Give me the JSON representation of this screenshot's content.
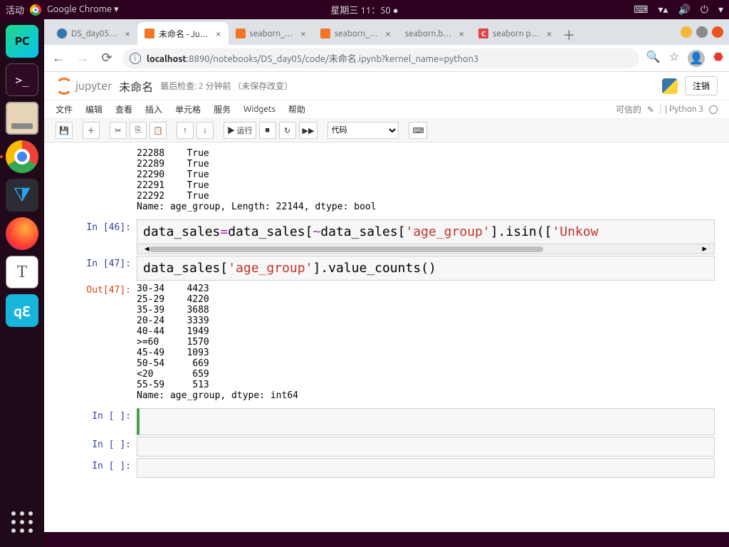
{
  "panel": {
    "activities": "活动",
    "app_title": "Google Chrome ▾",
    "clock": "星期三 11：50 ●"
  },
  "tabs": {
    "t1": "DS_day05…",
    "t2": "未命名 - Ju…",
    "t3": "seaborn_…",
    "t4": "seaborn_…",
    "t5": "seaborn.b…",
    "t6": "seaborn p…"
  },
  "addr": {
    "host": "localhost",
    "path": ":8890/notebooks/DS_day05/code/未命名.ipynb?kernel_name=python3"
  },
  "jy": {
    "brand": "jupyter",
    "title": "未命名",
    "checkpoint": "最后检查: 2 分钟前 （未保存改变）",
    "logout": "注销",
    "menu": {
      "file": "文件",
      "edit": "编辑",
      "view": "查看",
      "insert": "插入",
      "cell": "单元格",
      "kernel": "服务",
      "widgets": "Widgets",
      "help": "帮助"
    },
    "trusted": "可信的",
    "kernel": "Python 3",
    "run": "▶ 运行",
    "celltype": "代码"
  },
  "cells": {
    "out_top": "22288    True\n22289    True\n22290    True\n22291    True\n22292    True\nName: age_group, Length: 22144, dtype: bool",
    "in46_prompt": "In [46]:",
    "in47_prompt": "In [47]:",
    "out47_prompt": "Out[47]:",
    "empty_prompt": "In [ ]:",
    "out47": "30-34    4423\n25-29    4220\n35-39    3688\n20-24    3339\n40-44    1949\n>=60     1570\n45-49    1093\n50-54     669\n<20       659\n55-59     513\nName: age_group, dtype: int64",
    "code46_parts": {
      "a": "data_sales",
      "b": "=",
      "c": "data_sales[",
      "d": "~",
      "e": "data_sales[",
      "f": "'age_group'",
      "g": "].isin([",
      "h": "'Unkow"
    },
    "code47_parts": {
      "a": "data_sales[",
      "b": "'age_group'",
      "c": "].value_counts()"
    }
  },
  "chart_data": {
    "type": "table",
    "title": "data_sales['age_group'].value_counts()",
    "categories": [
      "30-34",
      "25-29",
      "35-39",
      "20-24",
      "40-44",
      ">=60",
      "45-49",
      "50-54",
      "<20",
      "55-59"
    ],
    "values": [
      4423,
      4220,
      3688,
      3339,
      1949,
      1570,
      1093,
      669,
      659,
      513
    ],
    "dtype": "int64",
    "name": "age_group"
  }
}
